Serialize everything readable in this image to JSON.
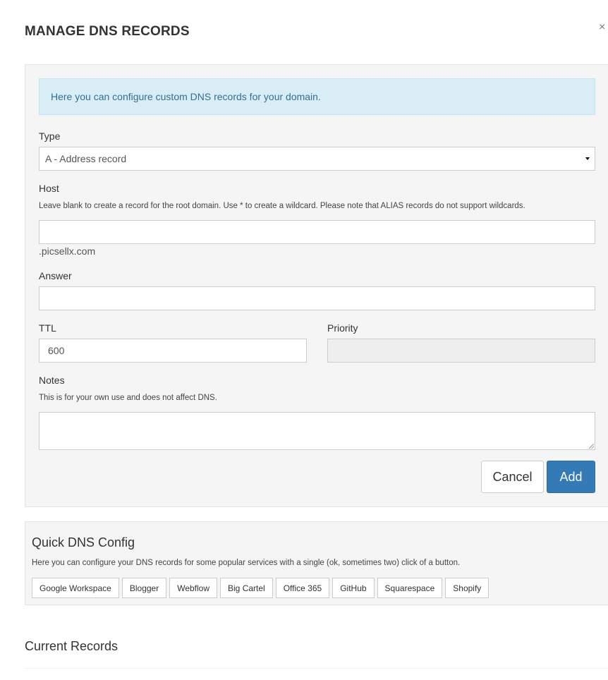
{
  "modal": {
    "title": "MANAGE DNS RECORDS",
    "close_glyph": "×"
  },
  "form": {
    "info_text": "Here you can configure custom DNS records for your domain.",
    "type": {
      "label": "Type",
      "selected": "A - Address record"
    },
    "host": {
      "label": "Host",
      "help": "Leave blank to create a record for the root domain. Use * to create a wildcard. Please note that ALIAS records do not support wildcards.",
      "value": "",
      "suffix": ".picsellx.com"
    },
    "answer": {
      "label": "Answer",
      "value": ""
    },
    "ttl": {
      "label": "TTL",
      "value": "600"
    },
    "priority": {
      "label": "Priority",
      "value": "",
      "disabled": true
    },
    "notes": {
      "label": "Notes",
      "help": "This is for your own use and does not affect DNS.",
      "value": ""
    },
    "cancel_label": "Cancel",
    "add_label": "Add"
  },
  "quick_config": {
    "title": "Quick DNS Config",
    "help": "Here you can configure your DNS records for some popular services with a single (ok, sometimes two) click of a button.",
    "services": [
      "Google Workspace",
      "Blogger",
      "Webflow",
      "Big Cartel",
      "Office 365",
      "GitHub",
      "Squarespace",
      "Shopify"
    ]
  },
  "current_records": {
    "title": "Current Records"
  },
  "colors": {
    "primary": "#337ab7",
    "info_bg": "#d9edf7",
    "info_text": "#31708f",
    "panel_bg": "#f5f5f5"
  }
}
